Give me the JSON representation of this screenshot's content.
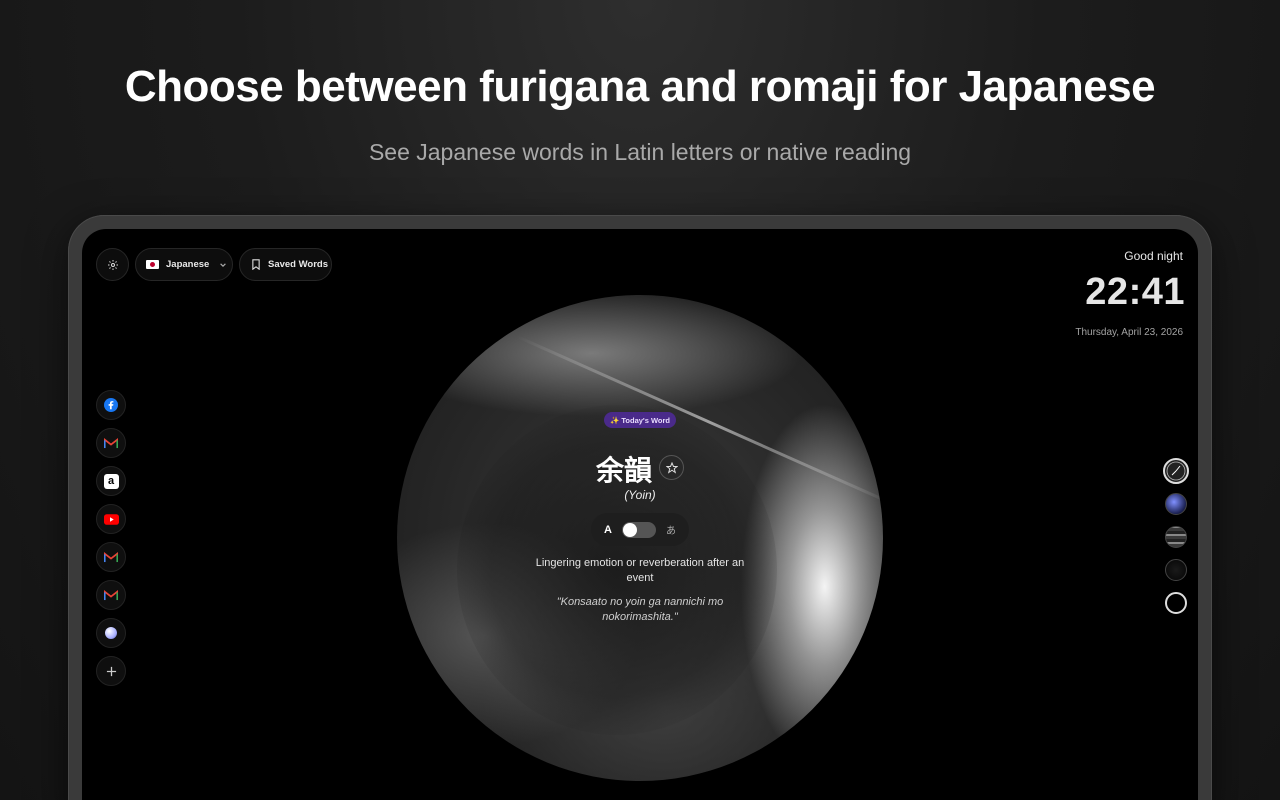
{
  "hero": {
    "title": "Choose between furigana and romaji for Japanese",
    "subtitle": "See Japanese words in Latin letters or native reading"
  },
  "toolbar": {
    "settings_icon": "gear-icon",
    "language_label": "Japanese",
    "language_flag": "japan-flag",
    "saved_words_label": "Saved Words"
  },
  "clock": {
    "greeting": "Good night",
    "time": "22:41",
    "date": "Thursday, April 23, 2026"
  },
  "dock": {
    "items": [
      {
        "name": "facebook",
        "icon": "facebook-icon",
        "color": "#1877f2"
      },
      {
        "name": "gmail",
        "icon": "gmail-icon",
        "color": "#ea4335"
      },
      {
        "name": "amazon",
        "icon": "amazon-icon",
        "color": "#ffffff"
      },
      {
        "name": "youtube",
        "icon": "youtube-icon",
        "color": "#ff0000"
      },
      {
        "name": "gmail",
        "icon": "gmail-icon",
        "color": "#ea4335"
      },
      {
        "name": "gmail",
        "icon": "gmail-icon",
        "color": "#ea4335"
      },
      {
        "name": "site",
        "icon": "globe-icon",
        "color": "#c8ccff"
      },
      {
        "name": "add-shortcut",
        "icon": "plus-icon",
        "color": "#cccccc"
      }
    ]
  },
  "themes": {
    "selected_index": 0,
    "options": [
      "clock-theme",
      "earth-theme",
      "wave-theme",
      "dark-theme",
      "outline-theme"
    ]
  },
  "word_card": {
    "badge": "✨ Today's Word",
    "word": "余韻",
    "reading": "(Yoin)",
    "toggle_latin": "A",
    "toggle_native": "あ",
    "toggle_mode": "romaji",
    "meaning": "Lingering emotion or reverberation after an event",
    "example": "\"Konsaato no yoin ga nannichi mo nokorimashita.\""
  },
  "colors": {
    "badge_bg": "#4a2a8a",
    "screen_bg": "#000000",
    "accent_text": "#e9dcff"
  }
}
